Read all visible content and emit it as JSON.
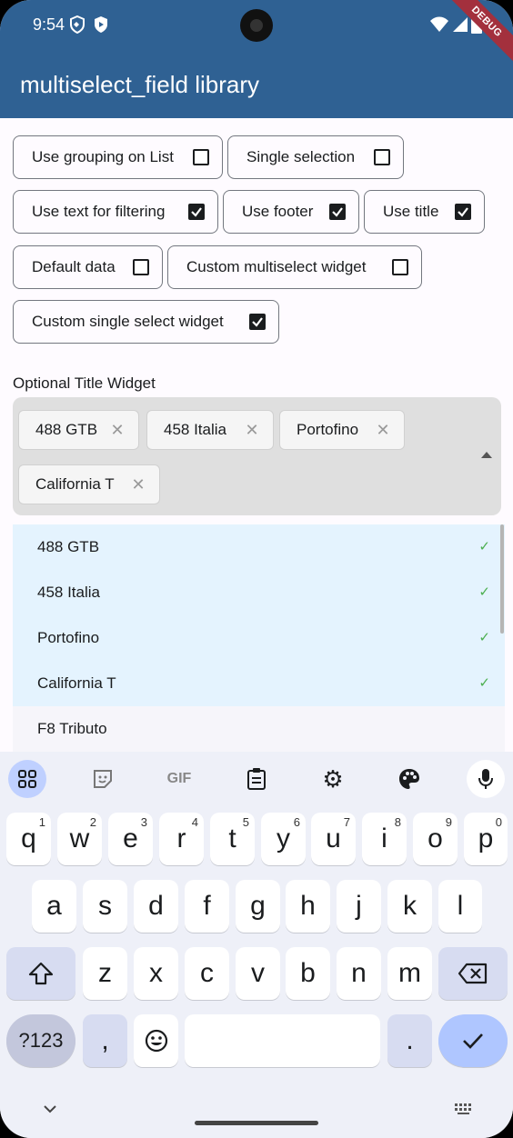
{
  "status_bar": {
    "time": "9:54",
    "debug": "DEBUG"
  },
  "app_bar": {
    "title": "multiselect_field library"
  },
  "options": [
    {
      "label": "Use grouping on List",
      "checked": false
    },
    {
      "label": "Single selection",
      "checked": false
    },
    {
      "label": "Use text for filtering",
      "checked": true
    },
    {
      "label": "Use footer",
      "checked": true
    },
    {
      "label": "Use title",
      "checked": true
    },
    {
      "label": "Default data",
      "checked": false
    },
    {
      "label": "Custom multiselect widget",
      "checked": false
    },
    {
      "label": "Custom single select widget",
      "checked": true
    }
  ],
  "field": {
    "title": "Optional Title Widget",
    "chips": [
      "488 GTB",
      "458 Italia",
      "Portofino",
      "California T"
    ]
  },
  "dropdown": {
    "items": [
      {
        "label": "488 GTB",
        "selected": true
      },
      {
        "label": "458 Italia",
        "selected": true
      },
      {
        "label": "Portofino",
        "selected": true
      },
      {
        "label": "California T",
        "selected": true
      },
      {
        "label": "F8 Tributo",
        "selected": false
      }
    ],
    "check_glyph": "✓"
  },
  "keyboard": {
    "toolbar": [
      "apps-icon",
      "sticker-icon",
      "gif-icon",
      "clipboard-icon",
      "settings-icon",
      "palette-icon",
      "mic-icon"
    ],
    "gif_label": "GIF",
    "row1": [
      {
        "k": "q",
        "h": "1"
      },
      {
        "k": "w",
        "h": "2"
      },
      {
        "k": "e",
        "h": "3"
      },
      {
        "k": "r",
        "h": "4"
      },
      {
        "k": "t",
        "h": "5"
      },
      {
        "k": "y",
        "h": "6"
      },
      {
        "k": "u",
        "h": "7"
      },
      {
        "k": "i",
        "h": "8"
      },
      {
        "k": "o",
        "h": "9"
      },
      {
        "k": "p",
        "h": "0"
      }
    ],
    "row2": [
      "a",
      "s",
      "d",
      "f",
      "g",
      "h",
      "j",
      "k",
      "l"
    ],
    "row3": [
      "z",
      "x",
      "c",
      "v",
      "b",
      "n",
      "m"
    ],
    "symbols_label": "?123",
    "comma_label": ",",
    "period_label": "."
  }
}
